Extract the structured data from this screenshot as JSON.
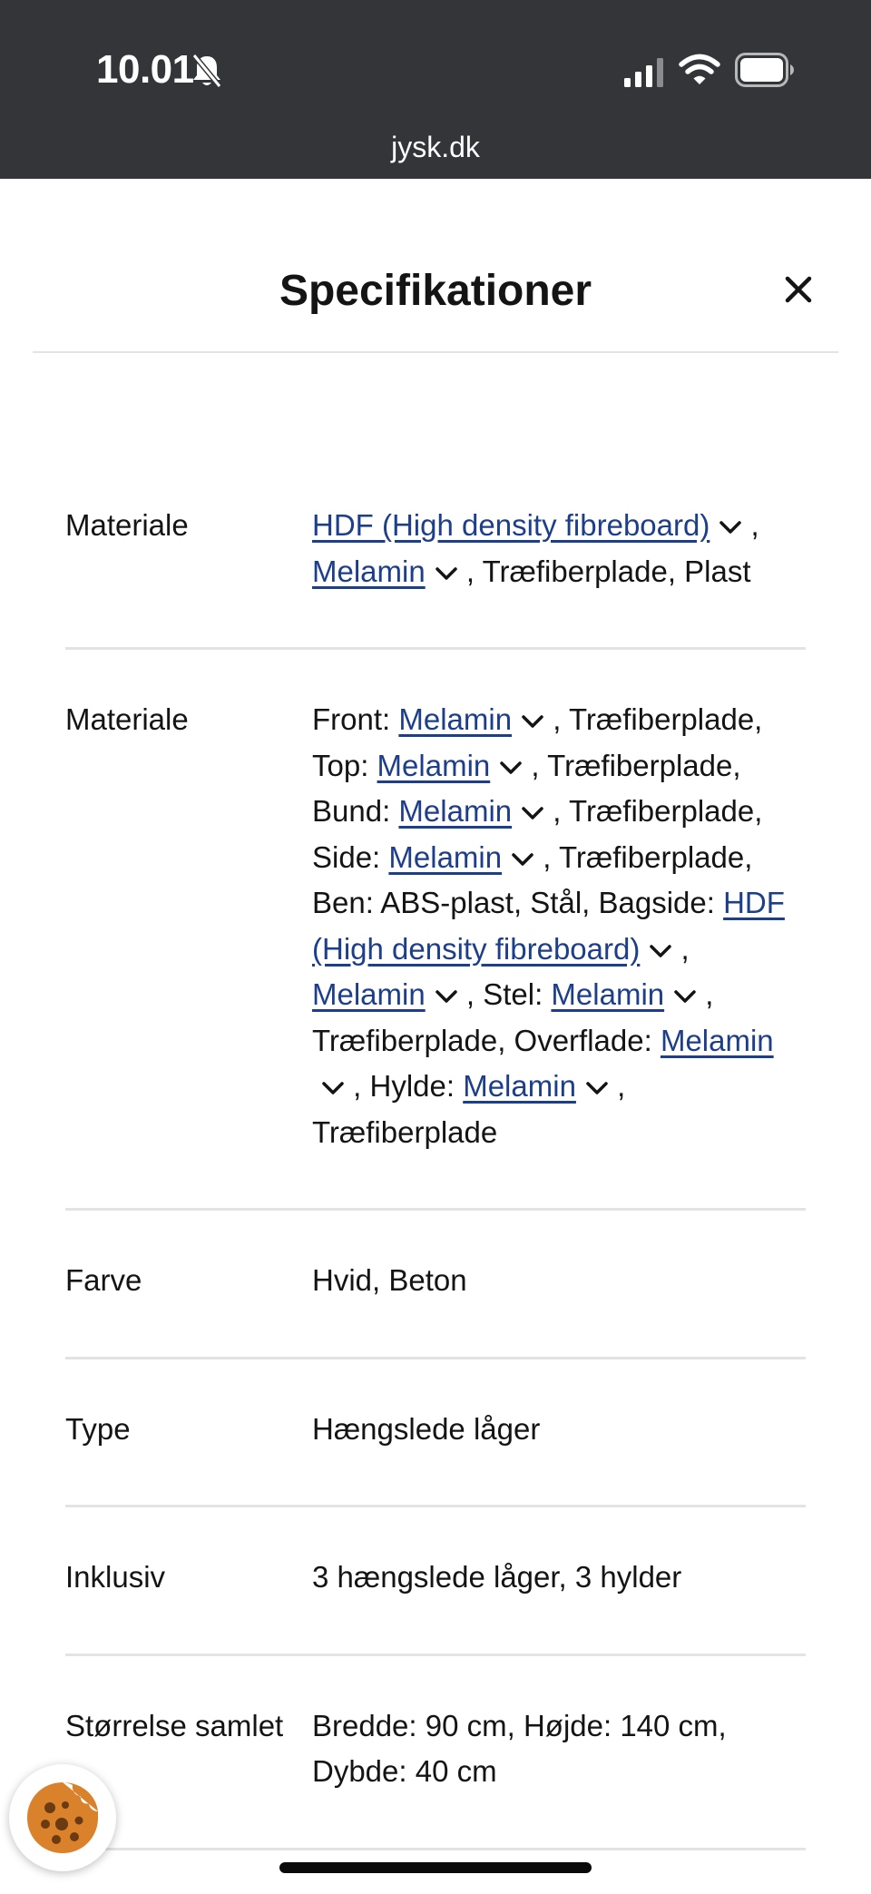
{
  "status_bar": {
    "time": "10.01",
    "url": "jysk.dk"
  },
  "modal": {
    "title": "Specifikationer",
    "close_icon": "close-icon"
  },
  "specs": [
    {
      "label": "Materiale",
      "parts": [
        {
          "text": "HDF (High density fibreboard)",
          "link": true
        },
        {
          "text": " , "
        },
        {
          "text": "Melamin",
          "link": true
        },
        {
          "text": " , Træfiberplade, Plast"
        }
      ]
    },
    {
      "label": "Materiale",
      "parts": [
        {
          "text": "Front: "
        },
        {
          "text": "Melamin",
          "link": true
        },
        {
          "text": " , Træfiberplade, Top: "
        },
        {
          "text": "Melamin",
          "link": true
        },
        {
          "text": " , Træfiberplade, Bund: "
        },
        {
          "text": "Melamin",
          "link": true
        },
        {
          "text": " , Træfiberplade, Side: "
        },
        {
          "text": "Melamin",
          "link": true
        },
        {
          "text": " , Træfiberplade, Ben: ABS-plast, Stål, Bagside: "
        },
        {
          "text": "HDF (High density fibreboard)",
          "link": true
        },
        {
          "text": " , "
        },
        {
          "text": "Melamin",
          "link": true
        },
        {
          "text": " , Stel: "
        },
        {
          "text": "Melamin",
          "link": true
        },
        {
          "text": " , Træfiberplade, Overflade: "
        },
        {
          "text": "Melamin",
          "link": true
        },
        {
          "text": " , Hylde: "
        },
        {
          "text": "Melamin",
          "link": true
        },
        {
          "text": " , Træfiberplade"
        }
      ]
    },
    {
      "label": "Farve",
      "parts": [
        {
          "text": "Hvid, Beton"
        }
      ]
    },
    {
      "label": "Type",
      "parts": [
        {
          "text": "Hængslede låger"
        }
      ]
    },
    {
      "label": "Inklusiv",
      "parts": [
        {
          "text": "3 hængslede låger, 3 hylder"
        }
      ]
    },
    {
      "label": "Størrelse samlet",
      "parts": [
        {
          "text": "Bredde: 90 cm, Højde: 140 cm, Dybde: 40 cm"
        }
      ]
    }
  ],
  "colors": {
    "status_bar_bg": "#333538",
    "link": "#1d3f8b",
    "text": "#141414",
    "divider": "#e2e4e4"
  },
  "icons": [
    "bell-slash-icon",
    "signal-icon",
    "wifi-icon",
    "battery-icon",
    "close-icon",
    "chevron-down-icon",
    "cookie-icon"
  ]
}
